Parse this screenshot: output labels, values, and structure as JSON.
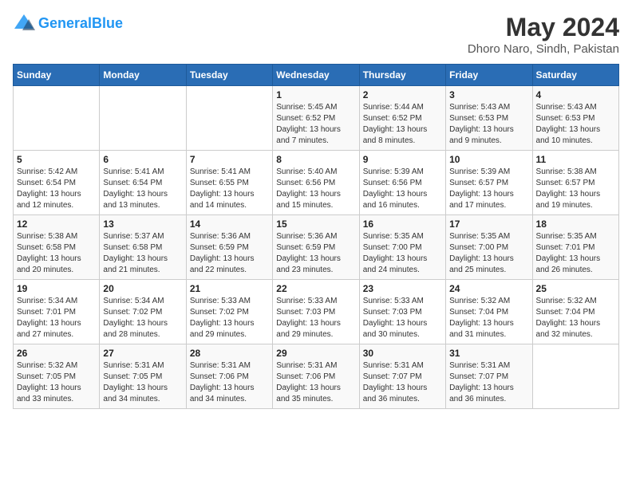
{
  "header": {
    "logo_line1": "General",
    "logo_line2": "Blue",
    "month": "May 2024",
    "location": "Dhoro Naro, Sindh, Pakistan"
  },
  "days_of_week": [
    "Sunday",
    "Monday",
    "Tuesday",
    "Wednesday",
    "Thursday",
    "Friday",
    "Saturday"
  ],
  "weeks": [
    [
      {
        "day": "",
        "info": ""
      },
      {
        "day": "",
        "info": ""
      },
      {
        "day": "",
        "info": ""
      },
      {
        "day": "1",
        "info": "Sunrise: 5:45 AM\nSunset: 6:52 PM\nDaylight: 13 hours and 7 minutes."
      },
      {
        "day": "2",
        "info": "Sunrise: 5:44 AM\nSunset: 6:52 PM\nDaylight: 13 hours and 8 minutes."
      },
      {
        "day": "3",
        "info": "Sunrise: 5:43 AM\nSunset: 6:53 PM\nDaylight: 13 hours and 9 minutes."
      },
      {
        "day": "4",
        "info": "Sunrise: 5:43 AM\nSunset: 6:53 PM\nDaylight: 13 hours and 10 minutes."
      }
    ],
    [
      {
        "day": "5",
        "info": "Sunrise: 5:42 AM\nSunset: 6:54 PM\nDaylight: 13 hours and 12 minutes."
      },
      {
        "day": "6",
        "info": "Sunrise: 5:41 AM\nSunset: 6:54 PM\nDaylight: 13 hours and 13 minutes."
      },
      {
        "day": "7",
        "info": "Sunrise: 5:41 AM\nSunset: 6:55 PM\nDaylight: 13 hours and 14 minutes."
      },
      {
        "day": "8",
        "info": "Sunrise: 5:40 AM\nSunset: 6:56 PM\nDaylight: 13 hours and 15 minutes."
      },
      {
        "day": "9",
        "info": "Sunrise: 5:39 AM\nSunset: 6:56 PM\nDaylight: 13 hours and 16 minutes."
      },
      {
        "day": "10",
        "info": "Sunrise: 5:39 AM\nSunset: 6:57 PM\nDaylight: 13 hours and 17 minutes."
      },
      {
        "day": "11",
        "info": "Sunrise: 5:38 AM\nSunset: 6:57 PM\nDaylight: 13 hours and 19 minutes."
      }
    ],
    [
      {
        "day": "12",
        "info": "Sunrise: 5:38 AM\nSunset: 6:58 PM\nDaylight: 13 hours and 20 minutes."
      },
      {
        "day": "13",
        "info": "Sunrise: 5:37 AM\nSunset: 6:58 PM\nDaylight: 13 hours and 21 minutes."
      },
      {
        "day": "14",
        "info": "Sunrise: 5:36 AM\nSunset: 6:59 PM\nDaylight: 13 hours and 22 minutes."
      },
      {
        "day": "15",
        "info": "Sunrise: 5:36 AM\nSunset: 6:59 PM\nDaylight: 13 hours and 23 minutes."
      },
      {
        "day": "16",
        "info": "Sunrise: 5:35 AM\nSunset: 7:00 PM\nDaylight: 13 hours and 24 minutes."
      },
      {
        "day": "17",
        "info": "Sunrise: 5:35 AM\nSunset: 7:00 PM\nDaylight: 13 hours and 25 minutes."
      },
      {
        "day": "18",
        "info": "Sunrise: 5:35 AM\nSunset: 7:01 PM\nDaylight: 13 hours and 26 minutes."
      }
    ],
    [
      {
        "day": "19",
        "info": "Sunrise: 5:34 AM\nSunset: 7:01 PM\nDaylight: 13 hours and 27 minutes."
      },
      {
        "day": "20",
        "info": "Sunrise: 5:34 AM\nSunset: 7:02 PM\nDaylight: 13 hours and 28 minutes."
      },
      {
        "day": "21",
        "info": "Sunrise: 5:33 AM\nSunset: 7:02 PM\nDaylight: 13 hours and 29 minutes."
      },
      {
        "day": "22",
        "info": "Sunrise: 5:33 AM\nSunset: 7:03 PM\nDaylight: 13 hours and 29 minutes."
      },
      {
        "day": "23",
        "info": "Sunrise: 5:33 AM\nSunset: 7:03 PM\nDaylight: 13 hours and 30 minutes."
      },
      {
        "day": "24",
        "info": "Sunrise: 5:32 AM\nSunset: 7:04 PM\nDaylight: 13 hours and 31 minutes."
      },
      {
        "day": "25",
        "info": "Sunrise: 5:32 AM\nSunset: 7:04 PM\nDaylight: 13 hours and 32 minutes."
      }
    ],
    [
      {
        "day": "26",
        "info": "Sunrise: 5:32 AM\nSunset: 7:05 PM\nDaylight: 13 hours and 33 minutes."
      },
      {
        "day": "27",
        "info": "Sunrise: 5:31 AM\nSunset: 7:05 PM\nDaylight: 13 hours and 34 minutes."
      },
      {
        "day": "28",
        "info": "Sunrise: 5:31 AM\nSunset: 7:06 PM\nDaylight: 13 hours and 34 minutes."
      },
      {
        "day": "29",
        "info": "Sunrise: 5:31 AM\nSunset: 7:06 PM\nDaylight: 13 hours and 35 minutes."
      },
      {
        "day": "30",
        "info": "Sunrise: 5:31 AM\nSunset: 7:07 PM\nDaylight: 13 hours and 36 minutes."
      },
      {
        "day": "31",
        "info": "Sunrise: 5:31 AM\nSunset: 7:07 PM\nDaylight: 13 hours and 36 minutes."
      },
      {
        "day": "",
        "info": ""
      }
    ]
  ]
}
